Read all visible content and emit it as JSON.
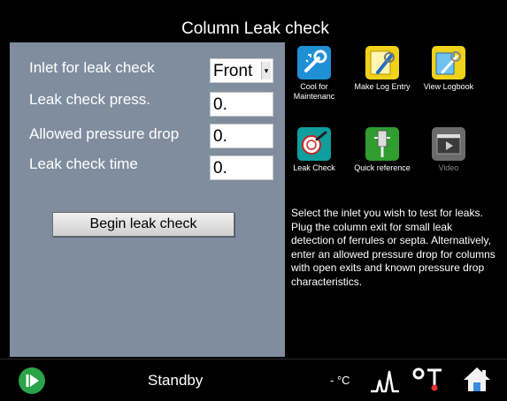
{
  "title": "Column Leak check",
  "form": {
    "inlet_label": "Inlet for leak check",
    "inlet_value": "Front",
    "press_label": "Leak check press.",
    "press_value": "0.",
    "drop_label": "Allowed pressure drop",
    "drop_value": "0.",
    "time_label": "Leak check time",
    "time_value": "0.",
    "begin_label": "Begin leak check"
  },
  "tiles": [
    {
      "label": "Cool for Maintenanc",
      "icon": "cool-maintenance-icon",
      "color": "#1f8fd6"
    },
    {
      "label": "Make Log Entry",
      "icon": "make-log-entry-icon",
      "color": "#f0d21a"
    },
    {
      "label": "View Logbook",
      "icon": "view-logbook-icon",
      "color": "#f0d21a"
    },
    {
      "label": "Leak Check",
      "icon": "leak-check-icon",
      "color": "#0f9e9e"
    },
    {
      "label": "Quick reference",
      "icon": "quick-reference-icon",
      "color": "#2f9d2f"
    },
    {
      "label": "Video",
      "icon": "video-icon",
      "color": "#6b6b6b",
      "disabled": true
    }
  ],
  "help": "Select the inlet you wish to test for leaks. Plug the column exit for small leak detection of ferrules or septa. Alternatively, enter an allowed pressure drop for columns with open exits and known pressure drop characteristics.",
  "status": {
    "state": "Standby",
    "temperature": "- °C"
  },
  "colors": {
    "panel": "#7f8d9f",
    "status_green": "#2aa34a"
  }
}
